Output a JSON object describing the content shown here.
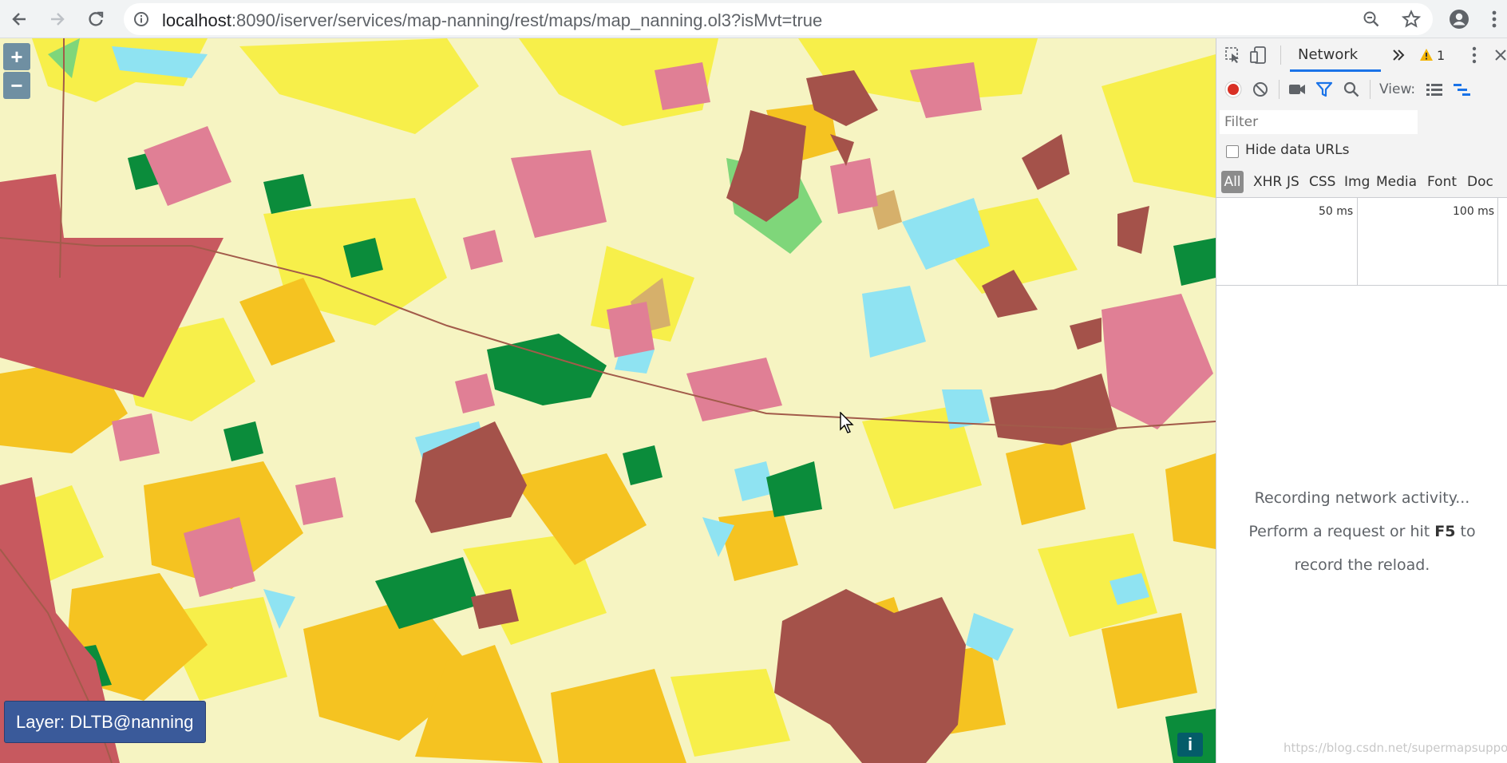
{
  "browser": {
    "url_host": "localhost",
    "url_path": ":8090/iserver/services/map-nanning/rest/maps/map_nanning.ol3?isMvt=true",
    "icons": [
      "back-arrow-icon",
      "forward-arrow-icon",
      "reload-icon",
      "info-icon",
      "zoom-icon",
      "star-icon",
      "profile-icon",
      "kebab-menu-icon"
    ]
  },
  "map": {
    "zoom_in": "+",
    "zoom_out": "−",
    "layer_label": "Layer: DLTB@nanning",
    "info_label": "i",
    "colors": {
      "background": "#f6f4c2",
      "yellow": "#f7ef4a",
      "orange": "#f5c321",
      "pink": "#e07f95",
      "red": "#c7595f",
      "brown": "#a4524a",
      "green": "#0b8c3b",
      "lightgreen": "#7fd67a",
      "cyan": "#8fe3f2",
      "tan": "#d6b06b"
    }
  },
  "devtools": {
    "active_tab": "Network",
    "warning_count": "1",
    "view_label": "View:",
    "filter_placeholder": "Filter",
    "hide_data_urls": "Hide data URLs",
    "types": [
      "All",
      "XHR",
      "JS",
      "CSS",
      "Img",
      "Media",
      "Font",
      "Doc"
    ],
    "timeline_labels": [
      "50 ms",
      "100 ms"
    ],
    "message_line1": "Recording network activity...",
    "message_line2_pre": "Perform a request or hit ",
    "message_line2_key": "F5",
    "message_line2_post": " to",
    "message_line3": "record the reload."
  },
  "watermark": "https://blog.csdn.net/supermapsupport"
}
